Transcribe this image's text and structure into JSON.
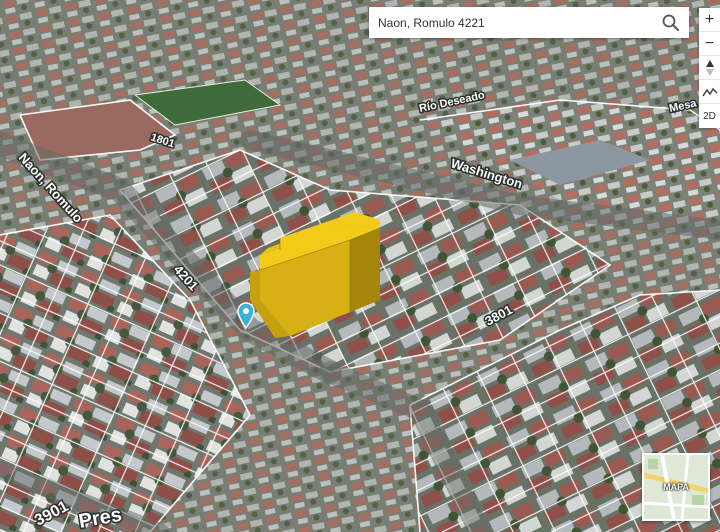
{
  "search": {
    "value": "Naon, Romulo 4221",
    "icon": "search-icon"
  },
  "controls": {
    "zoom_in": "+",
    "zoom_out": "−",
    "tilt_icon": "compass-icon",
    "terrain_icon": "terrain-icon",
    "view_mode": "2D"
  },
  "streets": {
    "naon": "Naon, Romulo",
    "washington": "Washington",
    "rio_label": "Río Deseado",
    "mesa": "Mesa",
    "bottom": "Pres",
    "park_label": "1801"
  },
  "numbers": {
    "n4201": "4201",
    "n3801": "3801",
    "n3901": "3901"
  },
  "minimap": {
    "label": "MAPA"
  },
  "colors": {
    "building": "#f3cc1a",
    "marker": "#3ab0d8",
    "lot_lines": "#ffffff"
  }
}
